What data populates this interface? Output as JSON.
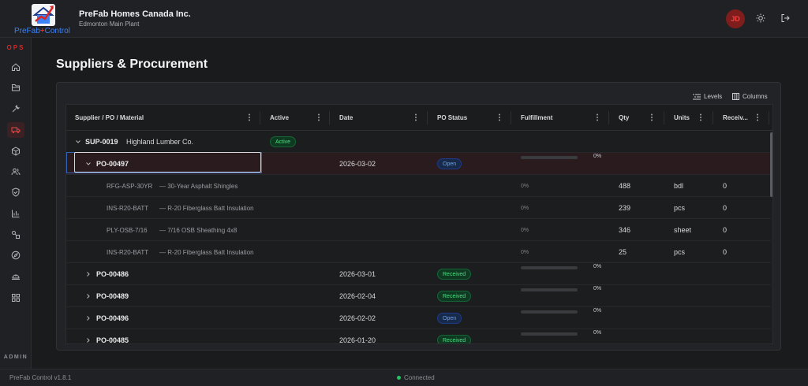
{
  "app": {
    "logo_text_a": "PreFab",
    "logo_text_plus": "+",
    "logo_text_b": "Control",
    "company": "PreFab Homes Canada Inc.",
    "plant": "Edmonton Main Plant",
    "user_initials": "JD"
  },
  "sidebar": {
    "section_ops": "OPS",
    "section_admin": "ADMIN",
    "items": [
      {
        "icon": "home-icon"
      },
      {
        "icon": "folder-icon"
      },
      {
        "icon": "wrench-icon"
      },
      {
        "icon": "truck-icon",
        "active": true
      },
      {
        "icon": "box-icon"
      },
      {
        "icon": "users-icon"
      },
      {
        "icon": "shield-check-icon"
      },
      {
        "icon": "bar-chart-icon"
      },
      {
        "icon": "shapes-icon"
      },
      {
        "icon": "compass-icon"
      },
      {
        "icon": "hard-hat-icon"
      },
      {
        "icon": "grid-icon"
      }
    ]
  },
  "page": {
    "title": "Suppliers & Procurement"
  },
  "toolbar": {
    "levels_label": "Levels",
    "columns_label": "Columns"
  },
  "grid": {
    "columns": [
      "Supplier / PO / Material",
      "Active",
      "Date",
      "PO Status",
      "Fulfillment",
      "Qty",
      "Units",
      "Receiv..."
    ],
    "supplier": {
      "id": "SUP-0019",
      "name": "Highland Lumber Co.",
      "status": "Active"
    },
    "po_open": {
      "id": "PO-00497",
      "date": "2026-03-02",
      "status": "Open",
      "fulfillment": "0%"
    },
    "materials": [
      {
        "sku": "RFG-ASP-30YR",
        "desc": "— 30-Year Asphalt Shingles",
        "fulfillment": "0%",
        "qty": "488",
        "units": "bdl",
        "received": "0"
      },
      {
        "sku": "INS-R20-BATT",
        "desc": "— R-20 Fiberglass Batt Insulation",
        "fulfillment": "0%",
        "qty": "239",
        "units": "pcs",
        "received": "0"
      },
      {
        "sku": "PLY-OSB-7/16",
        "desc": "— 7/16 OSB Sheathing 4x8",
        "fulfillment": "0%",
        "qty": "346",
        "units": "sheet",
        "received": "0"
      },
      {
        "sku": "INS-R20-BATT",
        "desc": "— R-20 Fiberglass Batt Insulation",
        "fulfillment": "0%",
        "qty": "25",
        "units": "pcs",
        "received": "0"
      }
    ],
    "pos": [
      {
        "id": "PO-00486",
        "date": "2026-03-01",
        "status": "Received",
        "fulfillment": "0%"
      },
      {
        "id": "PO-00489",
        "date": "2026-02-04",
        "status": "Received",
        "fulfillment": "0%"
      },
      {
        "id": "PO-00496",
        "date": "2026-02-02",
        "status": "Open",
        "fulfillment": "0%"
      },
      {
        "id": "PO-00485",
        "date": "2026-01-20",
        "status": "Received",
        "fulfillment": "0%"
      }
    ]
  },
  "footer": {
    "version": "PreFab Control v1.8.1",
    "connection": "Connected"
  },
  "colors": {
    "accent": "#dc2626",
    "open": "#60a5fa",
    "received": "#4ade80",
    "connected": "#22c55e"
  }
}
